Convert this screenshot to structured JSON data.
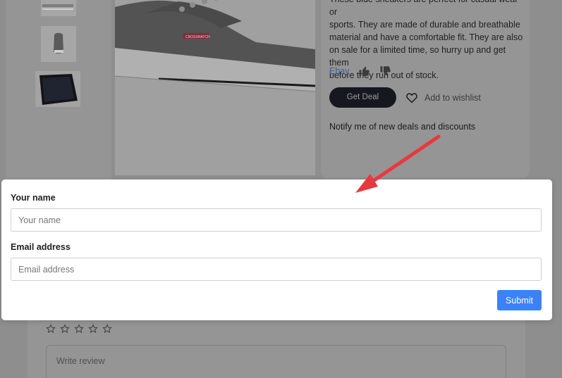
{
  "product": {
    "description_lines": [
      "These blue sneakers are perfect for casual wear or",
      "sports. They are made of durable and breathable",
      "material and have a comfortable fit. They are also",
      "on sale for a limited time, so hurry up and get them",
      "before they run out of stock."
    ],
    "shoe_brand_tag": "CROSSHATCH",
    "store_label": "Ebay",
    "get_deal_label": "Get Deal",
    "wishlist_label": "Add to wishlist",
    "notify_text": "Notify me of new deals and discounts"
  },
  "notify_form": {
    "name_label": "Your name",
    "name_placeholder": "Your name",
    "email_label": "Email address",
    "email_placeholder": "Email address",
    "submit_label": "Submit"
  },
  "review": {
    "star_count": 5,
    "placeholder": "Write review"
  },
  "colors": {
    "accent": "#3b82f6",
    "annotation_arrow": "#e8383d"
  },
  "icons": {
    "like": "thumbs-up-icon",
    "dislike": "thumbs-down-icon",
    "wishlist": "heart-icon",
    "star": "star-outline-icon"
  }
}
